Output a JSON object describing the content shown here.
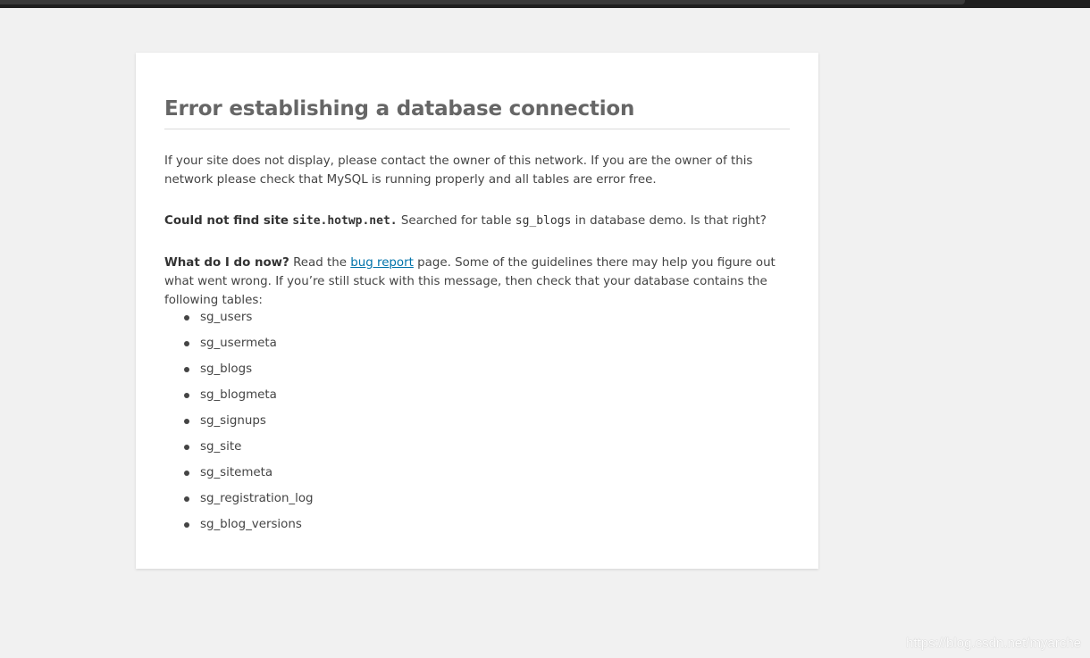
{
  "error": {
    "title": "Error establishing a database connection",
    "intro_line": "If your site does not display, please contact the owner of this network. If you are the owner of this network please check that MySQL is running properly and all tables are error free.",
    "not_found_label": "Could not find site",
    "site_domain": "site.hotwp.net.",
    "searched_prefix": "Searched for table",
    "table_name": "sg_blogs",
    "searched_middle": "in database",
    "database_name": "demo",
    "searched_suffix": ". Is that right?",
    "what_now_label": "What do I do now?",
    "read_the": "Read the",
    "bug_report_link": "bug report",
    "guidance_rest": "page. Some of the guidelines there may help you figure out what went wrong. If you’re still stuck with this message, then check that your database contains the following tables:",
    "tables": [
      "sg_users",
      "sg_usermeta",
      "sg_blogs",
      "sg_blogmeta",
      "sg_signups",
      "sg_site",
      "sg_sitemeta",
      "sg_registration_log",
      "sg_blog_versions"
    ]
  },
  "watermark": "https://blog.csdn.net/myarche",
  "colors": {
    "page_background": "#f1f1f1",
    "card_background": "#ffffff",
    "heading": "#666666",
    "body_text": "#444444",
    "link": "#0073aa",
    "top_bar": "#1f1f1f"
  }
}
